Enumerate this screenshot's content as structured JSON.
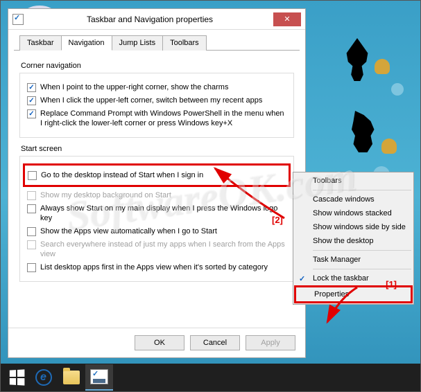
{
  "watermark": "SoftwareOK.com",
  "dialog": {
    "title": "Taskbar and Navigation properties",
    "tabs": [
      "Taskbar",
      "Navigation",
      "Jump Lists",
      "Toolbars"
    ],
    "active_tab": 1,
    "groups": {
      "corner": {
        "label": "Corner navigation",
        "items": [
          {
            "label": "When I point to the upper-right corner, show the charms",
            "checked": true,
            "disabled": false
          },
          {
            "label": "When I click the upper-left corner, switch between my recent apps",
            "checked": true,
            "disabled": false
          },
          {
            "label": "Replace Command Prompt with Windows PowerShell in the menu when I right-click the lower-left corner or press Windows key+X",
            "checked": true,
            "disabled": false
          }
        ]
      },
      "start": {
        "label": "Start screen",
        "items": [
          {
            "label": "Go to the desktop instead of Start when I sign in",
            "checked": false,
            "disabled": false,
            "highlight": true
          },
          {
            "label": "Show my desktop background on Start",
            "checked": false,
            "disabled": true
          },
          {
            "label": "Always show Start on my main display when I press the Windows logo key",
            "checked": false,
            "disabled": false
          },
          {
            "label": "Show the Apps view automatically when I go to Start",
            "checked": false,
            "disabled": false
          },
          {
            "label": "Search everywhere instead of just my apps when I search from the Apps view",
            "checked": false,
            "disabled": true
          },
          {
            "label": "List desktop apps first in the Apps view when it's sorted by category",
            "checked": false,
            "disabled": false
          }
        ]
      }
    },
    "buttons": {
      "ok": "OK",
      "cancel": "Cancel",
      "apply": "Apply"
    }
  },
  "context_menu": {
    "items": [
      {
        "label": "Toolbars",
        "sep_after": true
      },
      {
        "label": "Cascade windows"
      },
      {
        "label": "Show windows stacked"
      },
      {
        "label": "Show windows side by side"
      },
      {
        "label": "Show the desktop",
        "sep_after": true
      },
      {
        "label": "Task Manager",
        "sep_after": true
      },
      {
        "label": "Lock the taskbar",
        "checked": true
      },
      {
        "label": "Properties",
        "highlight": true
      }
    ]
  },
  "markers": {
    "m1": "[1]",
    "m2": "[2]"
  }
}
